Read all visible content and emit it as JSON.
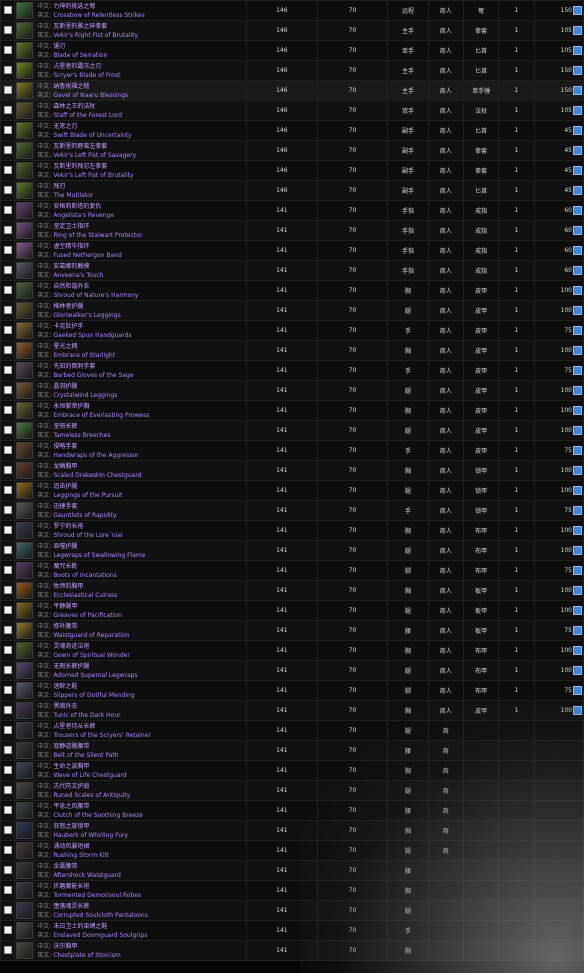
{
  "table": {
    "label_cn": "中文:",
    "label_en": "英文:",
    "rows": [
      {
        "cn": "力神的挑选之弩",
        "en": "Crossbow of Relentless Strikes",
        "ilvl": "146",
        "req": "70",
        "slot": "远程",
        "source": "商人",
        "type": "弩",
        "num": "1",
        "price": "150",
        "color": "#3f7a3a"
      },
      {
        "cn": "瓦斯里的雅之碎拳套",
        "en": "Vekir's Right Fist of Brutality",
        "ilvl": "146",
        "req": "70",
        "slot": "主手",
        "source": "商人",
        "type": "拳套",
        "num": "1",
        "price": "105",
        "color": "#4e6a2c"
      },
      {
        "cn": "锯刃",
        "en": "Blade of Serration",
        "ilvl": "146",
        "req": "70",
        "slot": "单手",
        "source": "商人",
        "type": "匕首",
        "num": "1",
        "price": "105",
        "color": "#5d7d22"
      },
      {
        "cn": "占星者的霜冻之刃",
        "en": "Scryer's Blade of Frost",
        "ilvl": "146",
        "req": "70",
        "slot": "主手",
        "source": "商人",
        "type": "匕首",
        "num": "1",
        "price": "150",
        "color": "#6f8c1e"
      },
      {
        "cn": "纳鲁祝福之槌",
        "en": "Gavel of Naaru Blessings",
        "ilvl": "146",
        "req": "70",
        "slot": "主手",
        "source": "商人",
        "type": "单手锤",
        "num": "1",
        "price": "150",
        "color": "#8a7a1e"
      },
      {
        "cn": "森林之王的法杖",
        "en": "Staff of the Forest Lord",
        "ilvl": "146",
        "req": "70",
        "slot": "双手",
        "source": "商人",
        "type": "法杖",
        "num": "1",
        "price": "105",
        "color": "#6a5a2a"
      },
      {
        "cn": "无常之刃",
        "en": "Swift Blade of Uncertainty",
        "ilvl": "146",
        "req": "70",
        "slot": "副手",
        "source": "商人",
        "type": "匕首",
        "num": "1",
        "price": "45",
        "color": "#5d7d22"
      },
      {
        "cn": "瓦斯里的野蛮左拳套",
        "en": "Vekir's Left Fist of Savagery",
        "ilvl": "146",
        "req": "70",
        "slot": "副手",
        "source": "商人",
        "type": "拳套",
        "num": "1",
        "price": "45",
        "color": "#4e6a2c"
      },
      {
        "cn": "瓦斯里的残忍左拳套",
        "en": "Vekir's Left Fist of Brutality",
        "ilvl": "146",
        "req": "70",
        "slot": "副手",
        "source": "商人",
        "type": "拳套",
        "num": "1",
        "price": "45",
        "color": "#4e6a2c"
      },
      {
        "cn": "残刃",
        "en": "The Mutilator",
        "ilvl": "146",
        "req": "70",
        "slot": "副手",
        "source": "商人",
        "type": "匕首",
        "num": "1",
        "price": "45",
        "color": "#5d7d22"
      },
      {
        "cn": "安格莉斯塔的复仇",
        "en": "Angelista's Revenge",
        "ilvl": "141",
        "req": "70",
        "slot": "手指",
        "source": "商人",
        "type": "戒指",
        "num": "1",
        "price": "60",
        "color": "#6a3f7a"
      },
      {
        "cn": "坚定卫士指环",
        "en": "Ring of the Stalwart Protector",
        "ilvl": "141",
        "req": "70",
        "slot": "手指",
        "source": "商人",
        "type": "戒指",
        "num": "1",
        "price": "60",
        "color": "#7a4f8a"
      },
      {
        "cn": "虚空精华指环",
        "en": "Fused Nethergon Band",
        "ilvl": "141",
        "req": "70",
        "slot": "手指",
        "source": "商人",
        "type": "戒指",
        "num": "1",
        "price": "60",
        "color": "#8a5a9a"
      },
      {
        "cn": "安葛娜的触摸",
        "en": "Anveena's Touch",
        "ilvl": "141",
        "req": "70",
        "slot": "手指",
        "source": "商人",
        "type": "戒指",
        "num": "1",
        "price": "60",
        "color": "#5a5a6a"
      },
      {
        "cn": "自然和谐外衣",
        "en": "Shroud of Nature's Harmony",
        "ilvl": "141",
        "req": "70",
        "slot": "胸",
        "source": "商人",
        "type": "皮甲",
        "num": "1",
        "price": "100",
        "color": "#4a6a3a"
      },
      {
        "cn": "格林者护腿",
        "en": "Gloriwalker's Leggings",
        "ilvl": "141",
        "req": "70",
        "slot": "腿",
        "source": "商人",
        "type": "皮甲",
        "num": "1",
        "price": "100",
        "color": "#6a5a2a"
      },
      {
        "cn": "卡克肚护手",
        "en": "Gaeked Spun Handguards",
        "ilvl": "141",
        "req": "70",
        "slot": "手",
        "source": "商人",
        "type": "皮甲",
        "num": "1",
        "price": "75",
        "color": "#8a6a2a"
      },
      {
        "cn": "星光之拥",
        "en": "Embrace of Starlight",
        "ilvl": "141",
        "req": "70",
        "slot": "胸",
        "source": "商人",
        "type": "皮甲",
        "num": "1",
        "price": "100",
        "color": "#9a5a2a"
      },
      {
        "cn": "先知的倒刺手套",
        "en": "Barbed Gloves of the Sage",
        "ilvl": "141",
        "req": "70",
        "slot": "手",
        "source": "商人",
        "type": "皮甲",
        "num": "1",
        "price": "75",
        "color": "#5a4a5a"
      },
      {
        "cn": "晶羽护腿",
        "en": "Crystalwind Leggings",
        "ilvl": "141",
        "req": "70",
        "slot": "腿",
        "source": "商人",
        "type": "皮甲",
        "num": "1",
        "price": "100",
        "color": "#7a5a2a"
      },
      {
        "cn": "永恒繁荣护胸",
        "en": "Embrace of Everlasting Prowess",
        "ilvl": "141",
        "req": "70",
        "slot": "胸",
        "source": "商人",
        "type": "皮甲",
        "num": "1",
        "price": "100",
        "color": "#6a6a2a"
      },
      {
        "cn": "坚韧长裤",
        "en": "Tameless Breeches",
        "ilvl": "141",
        "req": "70",
        "slot": "腿",
        "source": "商人",
        "type": "皮甲",
        "num": "1",
        "price": "100",
        "color": "#4a7a3a"
      },
      {
        "cn": "侵略手套",
        "en": "Handwraps of the Aggressor",
        "ilvl": "141",
        "req": "70",
        "slot": "手",
        "source": "商人",
        "type": "皮甲",
        "num": "1",
        "price": "75",
        "color": "#6a4a2a"
      },
      {
        "cn": "龙鳞胸甲",
        "en": "Scaled Drakeskin Chestguard",
        "ilvl": "141",
        "req": "70",
        "slot": "胸",
        "source": "商人",
        "type": "锁甲",
        "num": "1",
        "price": "100",
        "color": "#6a3a2a"
      },
      {
        "cn": "追击护腿",
        "en": "Leggings of the Pursuit",
        "ilvl": "141",
        "req": "70",
        "slot": "腿",
        "source": "商人",
        "type": "锁甲",
        "num": "1",
        "price": "100",
        "color": "#9a6a1a"
      },
      {
        "cn": "迅捷手套",
        "en": "Gauntlets of Rapidity",
        "ilvl": "141",
        "req": "70",
        "slot": "手",
        "source": "商人",
        "type": "锁甲",
        "num": "1",
        "price": "75",
        "color": "#5a5a5a"
      },
      {
        "cn": "罗宁的长袍",
        "en": "Shroud of the Lore`nial",
        "ilvl": "141",
        "req": "70",
        "slot": "胸",
        "source": "商人",
        "type": "布甲",
        "num": "1",
        "price": "100",
        "color": "#3a3a5a"
      },
      {
        "cn": "吞噬护腿",
        "en": "Legwraps of Swallowing Flame",
        "ilvl": "141",
        "req": "70",
        "slot": "腿",
        "source": "商人",
        "type": "布甲",
        "num": "1",
        "price": "100",
        "color": "#3a6a6a"
      },
      {
        "cn": "魔咒长靴",
        "en": "Boots of Incantations",
        "ilvl": "141",
        "req": "70",
        "slot": "脚",
        "source": "商人",
        "type": "布甲",
        "num": "1",
        "price": "75",
        "color": "#5a3a6a"
      },
      {
        "cn": "牧师的胸甲",
        "en": "Ecclesiastical Cuirass",
        "ilvl": "141",
        "req": "70",
        "slot": "胸",
        "source": "商人",
        "type": "板甲",
        "num": "1",
        "price": "100",
        "color": "#9a5a1a"
      },
      {
        "cn": "平静腿甲",
        "en": "Greaves of Pacification",
        "ilvl": "141",
        "req": "70",
        "slot": "腿",
        "source": "商人",
        "type": "板甲",
        "num": "1",
        "price": "100",
        "color": "#8a6a1a"
      },
      {
        "cn": "修补腰带",
        "en": "Waistguard of Reparation",
        "ilvl": "141",
        "req": "70",
        "slot": "腰",
        "source": "商人",
        "type": "板甲",
        "num": "1",
        "price": "75",
        "color": "#9a7a2a"
      },
      {
        "cn": "灵魂奇迹法袍",
        "en": "Gown of Spiritual Wonder",
        "ilvl": "141",
        "req": "70",
        "slot": "胸",
        "source": "商人",
        "type": "布甲",
        "num": "1",
        "price": "100",
        "color": "#4a6a2a"
      },
      {
        "cn": "无瑕长裤护腿",
        "en": "Adorned Supernal Legwraps",
        "ilvl": "141",
        "req": "70",
        "slot": "腿",
        "source": "商人",
        "type": "布甲",
        "num": "1",
        "price": "100",
        "color": "#5a4a7a"
      },
      {
        "cn": "迷醉之鞋",
        "en": "Slippers of Dutiful Mending",
        "ilvl": "141",
        "req": "70",
        "slot": "脚",
        "source": "商人",
        "type": "布甲",
        "num": "1",
        "price": "75",
        "color": "#5a5a7a"
      },
      {
        "cn": "黑暗外衣",
        "en": "Tunic of the Dark Hour",
        "ilvl": "141",
        "req": "70",
        "slot": "胸",
        "source": "商人",
        "type": "皮甲",
        "num": "1",
        "price": "100",
        "color": "#4a3a5a"
      },
      {
        "cn": "占星者侍从长裤",
        "en": "Trousers of the Scryers' Retainer",
        "ilvl": "141",
        "req": "70",
        "slot": "腿",
        "source": "商",
        "type": "",
        "num": "",
        "price": "",
        "color": "#3a3a4a"
      },
      {
        "cn": "寂静道路腰带",
        "en": "Belt of the Silent Path",
        "ilvl": "141",
        "req": "70",
        "slot": "腰",
        "source": "商",
        "type": "",
        "num": "",
        "price": "",
        "color": "#3a3a3a"
      },
      {
        "cn": "生命之波胸甲",
        "en": "Wave of Life Chestguard",
        "ilvl": "141",
        "req": "70",
        "slot": "胸",
        "source": "商",
        "type": "",
        "num": "",
        "price": "",
        "color": "#3a4a5a"
      },
      {
        "cn": "古代符文护肩",
        "en": "Runed Scales of Antiquity",
        "ilvl": "141",
        "req": "70",
        "slot": "腿",
        "source": "商",
        "type": "",
        "num": "",
        "price": "",
        "color": "#4a4a4a"
      },
      {
        "cn": "平息之风腰带",
        "en": "Clutch of the Soothing Breeze",
        "ilvl": "141",
        "req": "70",
        "slot": "腰",
        "source": "商",
        "type": "",
        "num": "",
        "price": "",
        "color": "#3a4a4a"
      },
      {
        "cn": "狂怒之旋锁甲",
        "en": "Hauberk of Whirling Fury",
        "ilvl": "141",
        "req": "70",
        "slot": "胸",
        "source": "商",
        "type": "",
        "num": "",
        "price": "",
        "color": "#2a3a5a"
      },
      {
        "cn": "涌动风暴短裙",
        "en": "Rushing Storm Kilt",
        "ilvl": "141",
        "req": "70",
        "slot": "腿",
        "source": "商",
        "type": "",
        "num": "",
        "price": "",
        "color": "#4a3a3a"
      },
      {
        "cn": "余震腰带",
        "en": "Aftershock Waistguard",
        "ilvl": "141",
        "req": "70",
        "slot": "腰",
        "source": "",
        "type": "",
        "num": "",
        "price": "",
        "color": "#3a3a3a"
      },
      {
        "cn": "折磨魔能长袍",
        "en": "Tormented Demonsoul Robes",
        "ilvl": "141",
        "req": "70",
        "slot": "胸",
        "source": "",
        "type": "",
        "num": "",
        "price": "",
        "color": "#3a3a4a"
      },
      {
        "cn": "堕落魂灵长裤",
        "en": "Corrupted Soulcloth Pantaloons",
        "ilvl": "141",
        "req": "70",
        "slot": "腿",
        "source": "",
        "type": "",
        "num": "",
        "price": "",
        "color": "#3a3a5a"
      },
      {
        "cn": "末日卫士的束缚之鞋",
        "en": "Enslaved Doomguard Soulgrips",
        "ilvl": "141",
        "req": "70",
        "slot": "手",
        "source": "",
        "type": "",
        "num": "",
        "price": "",
        "color": "#4a4a4a"
      },
      {
        "cn": "沃尔胸甲",
        "en": "Chestplate of Stoicism",
        "ilvl": "141",
        "req": "70",
        "slot": "胸",
        "source": "",
        "type": "",
        "num": "",
        "price": "",
        "color": "#4a4a3a"
      }
    ]
  }
}
